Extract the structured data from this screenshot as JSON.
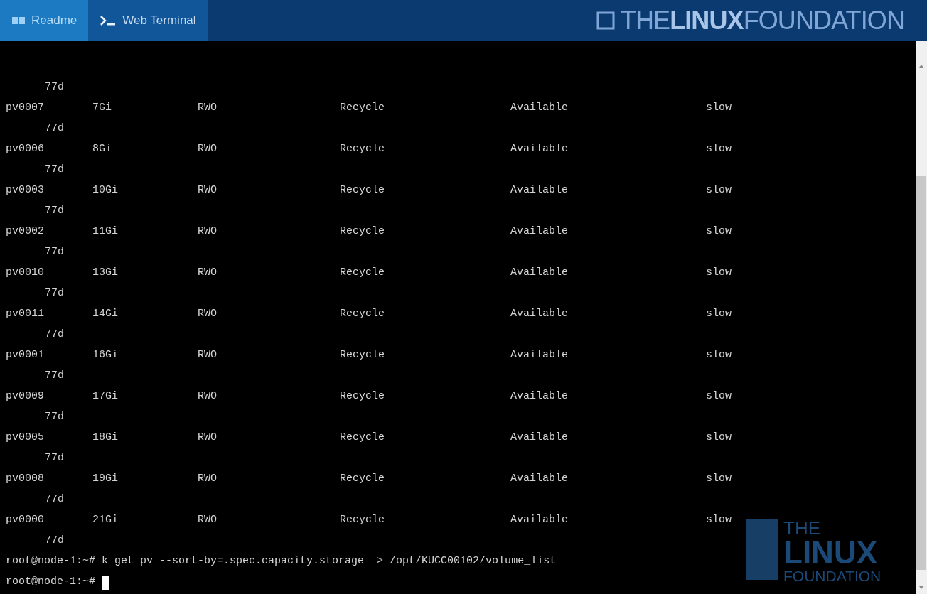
{
  "tabs": [
    {
      "label": "Readme",
      "selected": false,
      "kind": "book"
    },
    {
      "label": "Web Terminal",
      "selected": true,
      "kind": "prompt"
    }
  ],
  "brand": {
    "prefix": "THE",
    "bold": "LINUX",
    "suffix": "FOUNDATION"
  },
  "terminal": {
    "leading_age": "77d",
    "rows": [
      {
        "name": "pv0007",
        "capacity": "7Gi",
        "access": "RWO",
        "reclaim": "Recycle",
        "status": "Available",
        "class": "slow",
        "age": "77d"
      },
      {
        "name": "pv0006",
        "capacity": "8Gi",
        "access": "RWO",
        "reclaim": "Recycle",
        "status": "Available",
        "class": "slow",
        "age": "77d"
      },
      {
        "name": "pv0003",
        "capacity": "10Gi",
        "access": "RWO",
        "reclaim": "Recycle",
        "status": "Available",
        "class": "slow",
        "age": "77d"
      },
      {
        "name": "pv0002",
        "capacity": "11Gi",
        "access": "RWO",
        "reclaim": "Recycle",
        "status": "Available",
        "class": "slow",
        "age": "77d"
      },
      {
        "name": "pv0010",
        "capacity": "13Gi",
        "access": "RWO",
        "reclaim": "Recycle",
        "status": "Available",
        "class": "slow",
        "age": "77d"
      },
      {
        "name": "pv0011",
        "capacity": "14Gi",
        "access": "RWO",
        "reclaim": "Recycle",
        "status": "Available",
        "class": "slow",
        "age": "77d"
      },
      {
        "name": "pv0001",
        "capacity": "16Gi",
        "access": "RWO",
        "reclaim": "Recycle",
        "status": "Available",
        "class": "slow",
        "age": "77d"
      },
      {
        "name": "pv0009",
        "capacity": "17Gi",
        "access": "RWO",
        "reclaim": "Recycle",
        "status": "Available",
        "class": "slow",
        "age": "77d"
      },
      {
        "name": "pv0005",
        "capacity": "18Gi",
        "access": "RWO",
        "reclaim": "Recycle",
        "status": "Available",
        "class": "slow",
        "age": "77d"
      },
      {
        "name": "pv0008",
        "capacity": "19Gi",
        "access": "RWO",
        "reclaim": "Recycle",
        "status": "Available",
        "class": "slow",
        "age": "77d"
      },
      {
        "name": "pv0000",
        "capacity": "21Gi",
        "access": "RWO",
        "reclaim": "Recycle",
        "status": "Available",
        "class": "slow",
        "age": "77d"
      }
    ],
    "prompt_lines": [
      {
        "prompt": "root@node-1:~#",
        "command": "k get pv --sort-by=.spec.capacity.storage  > /opt/KUCC00102/volume_list"
      },
      {
        "prompt": "root@node-1:~#"
      }
    ],
    "cursor": true
  },
  "background_logo": {
    "top": "THE",
    "middle": "LINUX",
    "bottom": "FOUNDATION"
  }
}
